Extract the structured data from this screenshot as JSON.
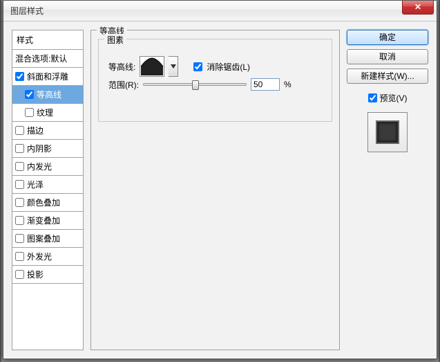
{
  "window": {
    "title": "图层样式",
    "close_glyph": "✕"
  },
  "styles_panel": {
    "header": "样式",
    "blend_options": "混合选项:默认",
    "items": [
      {
        "label": "斜面和浮雕",
        "checked": true,
        "child": false
      },
      {
        "label": "等高线",
        "checked": true,
        "child": true,
        "selected": true
      },
      {
        "label": "纹理",
        "checked": false,
        "child": true
      },
      {
        "label": "描边",
        "checked": false
      },
      {
        "label": "内阴影",
        "checked": false
      },
      {
        "label": "内发光",
        "checked": false
      },
      {
        "label": "光泽",
        "checked": false
      },
      {
        "label": "颜色叠加",
        "checked": false
      },
      {
        "label": "渐变叠加",
        "checked": false
      },
      {
        "label": "图案叠加",
        "checked": false
      },
      {
        "label": "外发光",
        "checked": false
      },
      {
        "label": "投影",
        "checked": false
      }
    ]
  },
  "center": {
    "group_title": "等高线",
    "fieldset_legend": "图素",
    "contour_label": "等高线:",
    "antialias_label": "消除锯齿(L)",
    "antialias_checked": true,
    "range_label": "范围(R):",
    "range_value": "50",
    "range_unit": "%"
  },
  "right": {
    "ok": "确定",
    "cancel": "取消",
    "new_style": "新建样式(W)...",
    "preview_label": "预览(V)",
    "preview_checked": true
  }
}
